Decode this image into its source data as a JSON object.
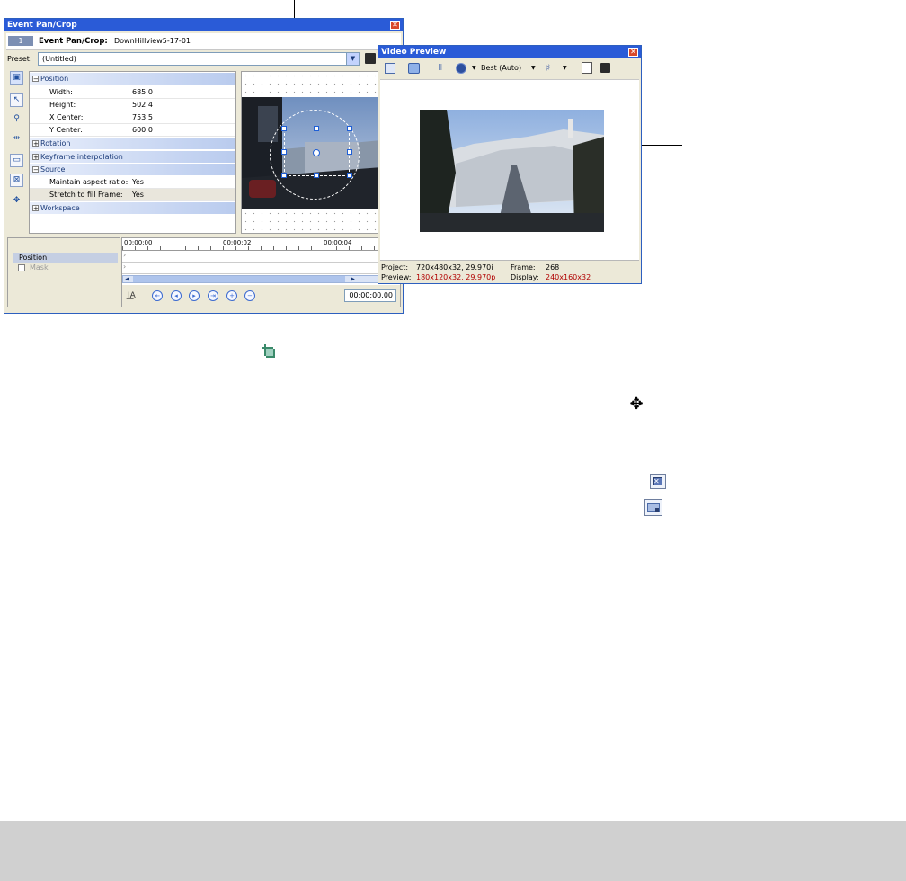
{
  "pan_crop": {
    "title": "Event Pan/Crop",
    "header_badge": "1",
    "header_label": "Event Pan/Crop:",
    "header_file": "DownHillview5-17-01",
    "preset_label": "Preset:",
    "preset_value": "(Untitled)",
    "groups": {
      "position": "Position",
      "rotation": "Rotation",
      "keyframe": "Keyframe interpolation",
      "source": "Source",
      "workspace": "Workspace"
    },
    "properties": [
      {
        "label": "Width:",
        "value": "685.0"
      },
      {
        "label": "Height:",
        "value": "502.4"
      },
      {
        "label": "X Center:",
        "value": "753.5"
      },
      {
        "label": "Y Center:",
        "value": "600.0"
      }
    ],
    "source_props": [
      {
        "label": "Maintain aspect ratio:",
        "value": "Yes"
      },
      {
        "label": "Stretch to fill Frame:",
        "value": "Yes"
      }
    ],
    "timeline": {
      "ticks": [
        "00:00:00",
        "00:00:02",
        "00:00:04"
      ],
      "track_position": "Position",
      "track_mask": "Mask",
      "timecode": "00:00:00.00",
      "mask_checked": false
    }
  },
  "video_preview": {
    "title": "Video Preview",
    "quality": "Best (Auto)",
    "project_label": "Project:",
    "project_value": "720x480x32, 29.970i",
    "preview_label": "Preview:",
    "preview_value": "180x120x32, 29.970p",
    "frame_label": "Frame:",
    "frame_value": "268",
    "display_label": "Display:",
    "display_value": "240x160x32"
  },
  "colors": {
    "titlebar": "#2A5BD7",
    "window_bg": "#ECE9D8",
    "accent_red": "#B00000",
    "group_text": "#1a3a78"
  },
  "floating_icons": [
    "crop-icon",
    "move-icon",
    "fit-frame-icon",
    "match-output-icon"
  ]
}
